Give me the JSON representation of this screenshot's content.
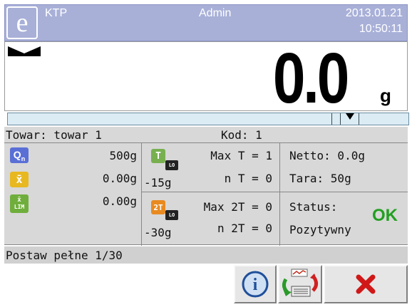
{
  "header": {
    "app_name": "KTP",
    "user": "Admin",
    "date": "2013.01.21",
    "time": "10:50:11"
  },
  "display": {
    "weight": "0.0",
    "unit": "g",
    "indicators": [
      "zero-indicator-icon"
    ]
  },
  "product_row": {
    "product_label": "Towar: towar 1",
    "code_label": "Kod: 1"
  },
  "stats": {
    "qn": {
      "icon": "Qn",
      "value": "500g",
      "color": "#5a6fd6"
    },
    "mean": {
      "icon": "x̄",
      "value": "0.00g",
      "color": "#e8b820"
    },
    "mean_lim": {
      "icon": "x̄ LIM",
      "value": "0.00g",
      "color": "#6fae3c"
    },
    "t_error": {
      "icon": "T",
      "lo": "LO",
      "limit": "-15g",
      "max_label": "Max T = 1",
      "n_label": "n T = 0",
      "color": "#78b050"
    },
    "t2_error": {
      "icon": "2T",
      "lo": "LO",
      "limit": "-30g",
      "max_label": "Max 2T = 0",
      "n_label": "n 2T = 0",
      "color": "#e88a20"
    },
    "netto": "Netto: 0.0g",
    "tara": "Tara: 50g",
    "status_label": "Status:",
    "status_value": "Pozytywny",
    "status_ok": "OK",
    "ok_color": "#22a020"
  },
  "message": "Postaw pełne 1/30",
  "footer": {
    "buttons": [
      "info-button",
      "export-report-button",
      "cancel-button"
    ],
    "info_icon_text": "i"
  }
}
